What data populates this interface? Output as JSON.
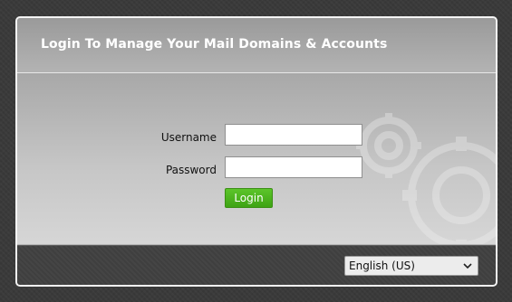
{
  "panel": {
    "title": "Login To Manage Your Mail Domains & Accounts"
  },
  "form": {
    "username_label": "Username",
    "username_value": "",
    "password_label": "Password",
    "password_value": "",
    "login_button": "Login"
  },
  "footer": {
    "language_selected": "English (US)"
  },
  "colors": {
    "accent_button": "#4cb41f",
    "background": "#3a3a3a",
    "panel_body": "#c0c0c0"
  },
  "icons": {
    "select_arrow": "chevron-down-icon",
    "decoration": "gear-icon"
  }
}
